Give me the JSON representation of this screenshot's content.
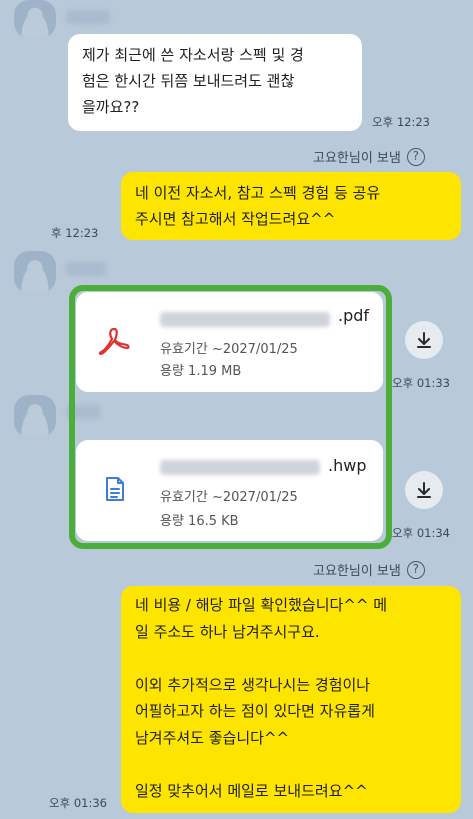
{
  "messages": {
    "m1": {
      "text": "제가 최근에 쓴 자소서랑 스펙 및 경\n험은 한시간 뒤쯤 보내드려도 괜찮\n을까요??",
      "time": "오후 12:23"
    },
    "sender1": "고요한님이 보냄",
    "m2": {
      "text": "네 이전 자소서, 참고 스펙 경험 등 공유\n주시면 참고해서 작업드려요^^",
      "time": "후 12:23"
    },
    "sender2": "고요한님이 보냄",
    "m3": {
      "text": "네 비용 / 해당 파일 확인했습니다^^ 메\n일 주소도 하나 남겨주시구요.\n\n이외 추가적으로 생각나시는 경험이나\n어필하고자 하는 점이 있다면 자유롭게\n남겨주셔도 좋습니다^^\n\n일정 맞추어서 메일로 보내드려요^^",
      "time": "오후 01:36"
    }
  },
  "files": [
    {
      "ext": ".pdf",
      "expiry": "유효기간 ~2027/01/25",
      "size": "용량 1.19 MB",
      "time": "오후 01:33",
      "icon": "pdf-icon",
      "color": "#e0322f"
    },
    {
      "ext": ".hwp",
      "expiry": "유효기간 ~2027/01/25",
      "size": "용량 16.5 KB",
      "time": "오후 01:34",
      "icon": "document-icon",
      "color": "#3b7ddb"
    }
  ],
  "help_glyph": "?",
  "colors": {
    "background": "#b8c9d9",
    "my_bubble": "#fee500",
    "other_bubble": "#ffffff",
    "highlight": "#4cae3a"
  }
}
